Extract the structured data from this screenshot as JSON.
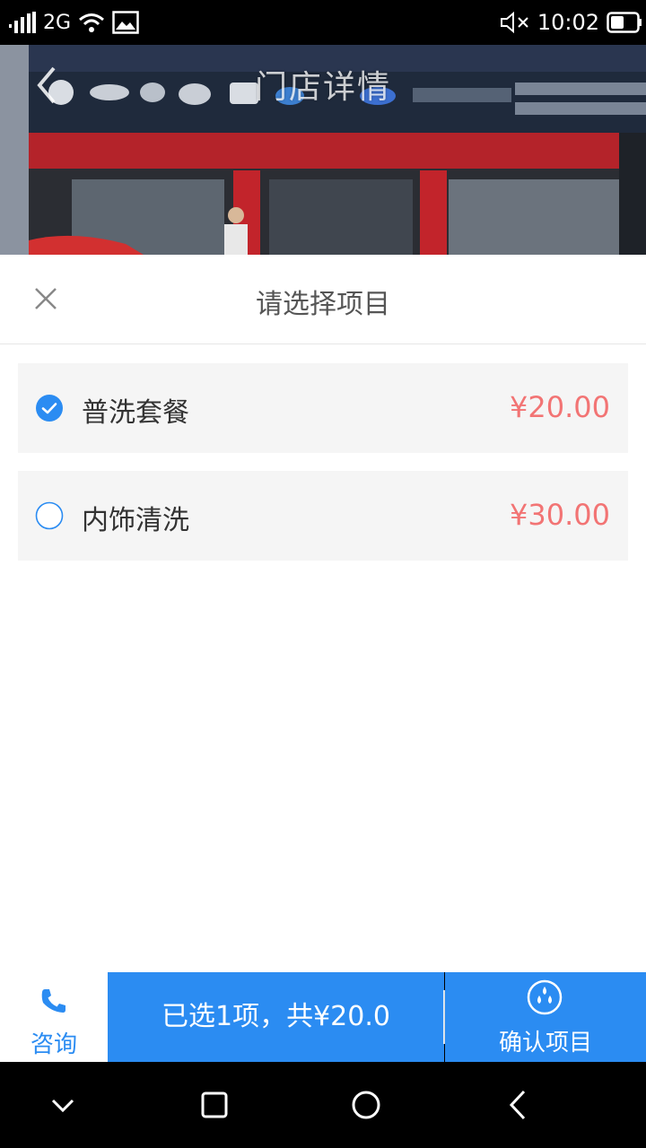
{
  "status_bar": {
    "network": "2G",
    "time": "10:02",
    "icons": [
      "signal-icon",
      "wifi-icon",
      "image-icon",
      "mute-icon",
      "battery-icon"
    ]
  },
  "header": {
    "title": "门店详情",
    "back_icon": "chevron-left-icon"
  },
  "sheet": {
    "title": "请选择项目",
    "close_icon": "close-icon",
    "options": [
      {
        "name": "普洗套餐",
        "price": "¥20.00",
        "selected": true
      },
      {
        "name": "内饰清洗",
        "price": "¥30.00",
        "selected": false
      }
    ]
  },
  "bottom_bar": {
    "consult_label": "咨询",
    "summary": "已选1项，共¥20.0",
    "confirm_label": "确认项目"
  },
  "colors": {
    "accent": "#2b8cf2",
    "price": "#f27474",
    "option_bg": "#f5f5f5"
  },
  "nav_bar": {
    "icons": [
      "nav-down-icon",
      "nav-square-icon",
      "nav-circle-icon",
      "nav-back-icon"
    ]
  }
}
